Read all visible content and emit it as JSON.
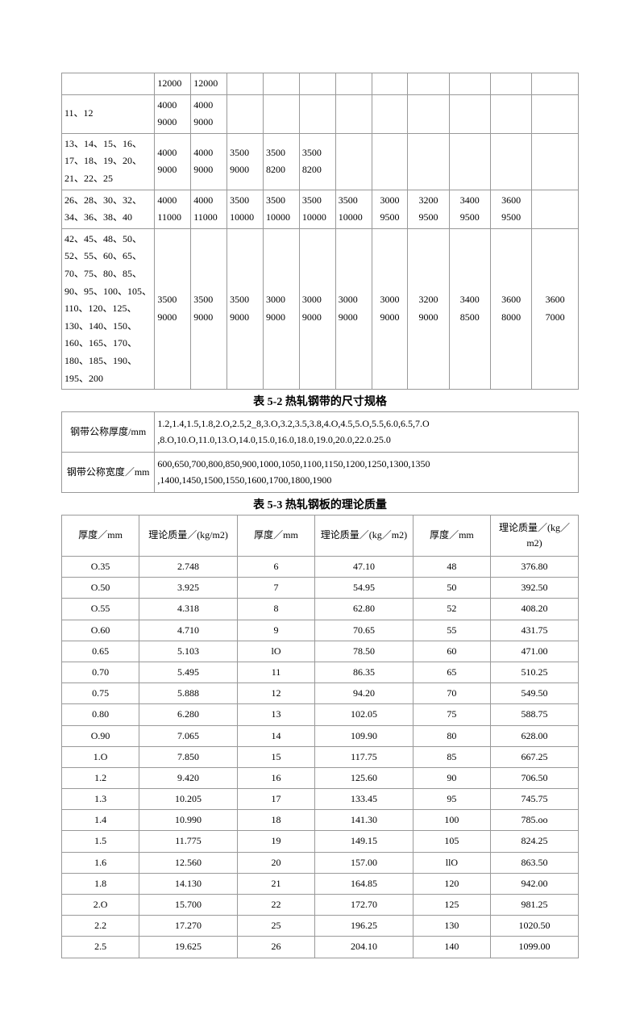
{
  "table1": {
    "rows": [
      {
        "label": "",
        "cells": [
          "12000",
          "12000",
          "",
          "",
          "",
          "",
          "",
          "",
          "",
          "",
          ""
        ]
      },
      {
        "label": "11、12",
        "cells": [
          "4000 9000",
          "4000 9000",
          "",
          "",
          "",
          "",
          "",
          "",
          "",
          "",
          ""
        ]
      },
      {
        "label": "13、14、15、16、17、18、19、20、21、22、25",
        "cells": [
          "4000 9000",
          "4000 9000",
          "3500 9000",
          "3500 8200",
          "3500 8200",
          "",
          "",
          "",
          "",
          "",
          ""
        ]
      },
      {
        "label": "26、28、30、32、34、36、38、40",
        "cells": [
          "4000 11000",
          "4000 11000",
          "3500 10000",
          "3500 10000",
          "3500 10000",
          "3500 10000",
          "3000 9500",
          "3200 9500",
          "3400 9500",
          "3600 9500",
          ""
        ]
      },
      {
        "label": "42、45、48、50、52、55、60、65、70、75、80、85、90、95、100、105、110、120、125、130、140、150、160、165、170、180、185、190、195、200",
        "cells": [
          "3500 9000",
          "3500 9000",
          "3500 9000",
          "3000 9000",
          "3000 9000",
          "3000 9000",
          "3000 9000",
          "3200 9000",
          "3400 8500",
          "3600 8000",
          "3600 7000"
        ]
      }
    ]
  },
  "heading2": "表 5-2 热轧钢带的尺寸规格",
  "table2": {
    "rows": [
      {
        "label": "钢带公称厚度/mm",
        "value": "1.2,1.4,1.5,1.8,2.O,2.5,2_8,3.O,3.2,3.5,3.8,4.O,4.5,5.O,5.5,6.0,6.5,7.O ,8.O,10.O,11.0,13.O,14.0,15.0,16.0,18.0,19.0,20.0,22.0.25.0"
      },
      {
        "label": "钢带公称宽度／mm",
        "value": "600,650,700,800,850,900,1000,1050,1100,1150,1200,1250,1300,1350 ,1400,1450,1500,1550,1600,1700,1800,1900"
      }
    ]
  },
  "heading3": "表 5-3 热轧钢板的理论质量",
  "table3": {
    "headers": [
      "厚度／mm",
      "理论质量／(kg/m2)",
      "厚度／mm",
      "理论质量／(kg／m2)",
      "厚度／mm",
      "理论质量／(kg／m2)"
    ],
    "rows": [
      [
        "O.35",
        "2.748",
        "6",
        "47.10",
        "48",
        "376.80"
      ],
      [
        "O.50",
        "3.925",
        "7",
        "54.95",
        "50",
        "392.50"
      ],
      [
        "O.55",
        "4.318",
        "8",
        "62.80",
        "52",
        "408.20"
      ],
      [
        "O.60",
        "4.710",
        "9",
        "70.65",
        "55",
        "431.75"
      ],
      [
        "0.65",
        "5.103",
        "lO",
        "78.50",
        "60",
        "471.00"
      ],
      [
        "0.70",
        "5.495",
        "11",
        "86.35",
        "65",
        "510.25"
      ],
      [
        "0.75",
        "5.888",
        "12",
        "94.20",
        "70",
        "549.50"
      ],
      [
        "0.80",
        "6.280",
        "13",
        "102.05",
        "75",
        "588.75"
      ],
      [
        "O.90",
        "7.065",
        "14",
        "109.90",
        "80",
        "628.00"
      ],
      [
        "1.O",
        "7.850",
        "15",
        "117.75",
        "85",
        "667.25"
      ],
      [
        "1.2",
        "9.420",
        "16",
        "125.60",
        "90",
        "706.50"
      ],
      [
        "1.3",
        "10.205",
        "17",
        "133.45",
        "95",
        "745.75"
      ],
      [
        "1.4",
        "10.990",
        "18",
        "141.30",
        "100",
        "785.oo"
      ],
      [
        "1.5",
        "11.775",
        "19",
        "149.15",
        "105",
        "824.25"
      ],
      [
        "1.6",
        "12.560",
        "20",
        "157.00",
        "llO",
        "863.50"
      ],
      [
        "1.8",
        "14.130",
        "21",
        "164.85",
        "120",
        "942.00"
      ],
      [
        "2.O",
        "15.700",
        "22",
        "172.70",
        "125",
        "981.25"
      ],
      [
        "2.2",
        "17.270",
        "25",
        "196.25",
        "130",
        "1020.50"
      ],
      [
        "2.5",
        "19.625",
        "26",
        "204.10",
        "140",
        "1099.00"
      ]
    ]
  }
}
